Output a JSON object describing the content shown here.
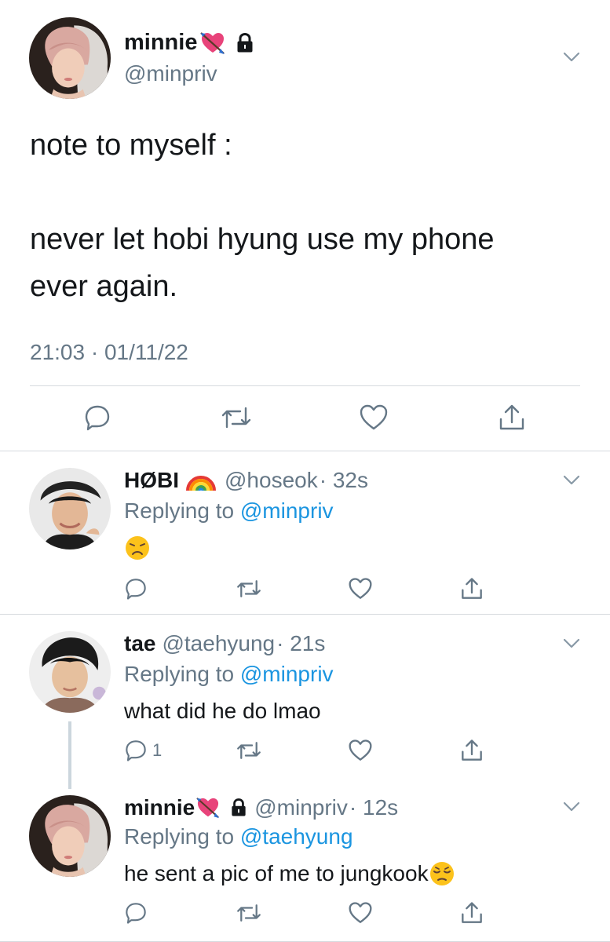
{
  "main_tweet": {
    "name": "minnie",
    "handle": "@minpriv",
    "text_line1": "note to myself :",
    "text_line2": "never let hobi hyung use my phone",
    "text_line3": "ever again.",
    "time": "21:03 · 01/11/22"
  },
  "replies": [
    {
      "name": "HØBI",
      "handle": "@hoseok",
      "time": "· 32s",
      "replying_prefix": "Replying to",
      "replying_to": "@minpriv",
      "text": "",
      "reply_count": ""
    },
    {
      "name": "tae",
      "handle": "@taehyung",
      "time": "· 21s",
      "replying_prefix": "Replying to",
      "replying_to": "@minpriv",
      "text": "what did he do lmao",
      "reply_count": "1"
    },
    {
      "name": "minnie",
      "handle": "@minpriv",
      "time": "· 12s",
      "replying_prefix": "Replying to",
      "replying_to": "@taehyung",
      "text": "he sent a pic of me to jungkook",
      "reply_count": ""
    }
  ],
  "icons": {
    "reply": "reply-icon",
    "retweet": "retweet-icon",
    "like": "heart-icon",
    "share": "share-icon",
    "menu": "chevron-down-icon",
    "lock": "lock-icon",
    "heart_arrow": "heart-with-arrow-emoji",
    "rainbow": "rainbow-emoji",
    "disappointed": "disappointed-face-emoji",
    "pensive": "pensive-face-emoji"
  },
  "colors": {
    "text": "#14171a",
    "secondary": "#657786",
    "link": "#1b95e0",
    "divider": "#d6dade",
    "thread_line": "#ccd6dd"
  }
}
